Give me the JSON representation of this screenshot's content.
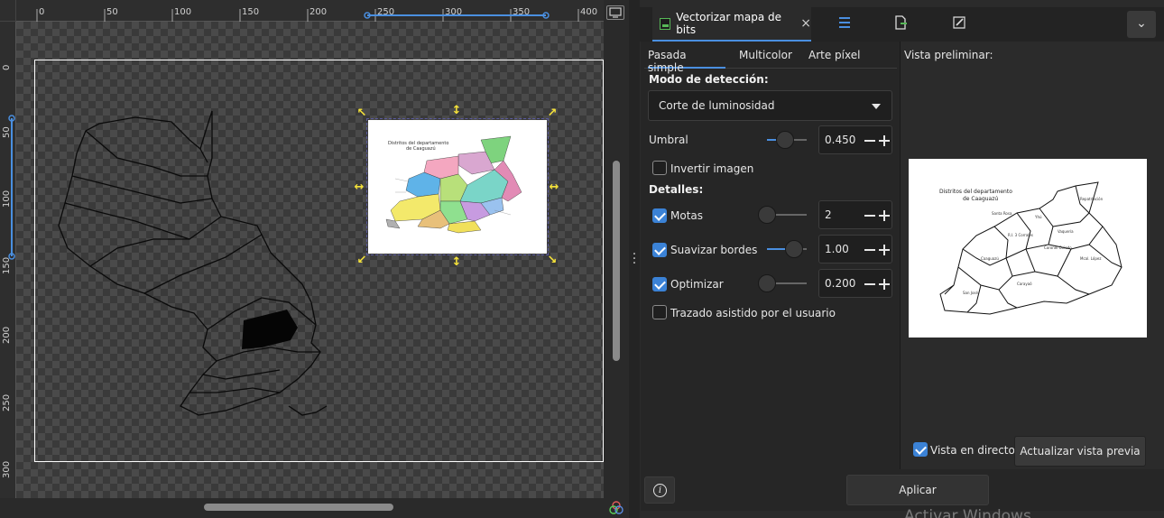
{
  "rulers": {
    "horizontal": [
      "0",
      "50",
      "100",
      "150",
      "200",
      "250",
      "300",
      "350",
      "400"
    ],
    "vertical": [
      "0",
      "50",
      "100",
      "150",
      "200",
      "250",
      "300"
    ]
  },
  "dialog": {
    "tab_title": "Vectorizar mapa de bits",
    "close_glyph": "×",
    "dock_icons": [
      "layers-icon",
      "export-icon",
      "edit-icon"
    ],
    "mode_tabs": [
      "Pasada simple",
      "Multicolor",
      "Arte píxel"
    ],
    "detection_mode_label": "Modo de detección:",
    "detection_mode_value": "Corte de luminosidad",
    "threshold_label": "Umbral",
    "threshold_value": "0.450",
    "invert_label": "Invertir imagen",
    "invert_checked": false,
    "details_label": "Detalles:",
    "speckles_label": "Motas",
    "speckles_checked": true,
    "speckles_value": "2",
    "smooth_label": "Suavizar bordes",
    "smooth_checked": true,
    "smooth_value": "1.00",
    "optimize_label": "Optimizar",
    "optimize_checked": true,
    "optimize_value": "0.200",
    "user_assisted_label": "Trazado asistido por el usuario",
    "user_assisted_checked": false,
    "preview_label": "Vista preliminar:",
    "live_label": "Vista en directo",
    "live_checked": true,
    "refresh_label": "Actualizar vista previa",
    "apply_label": "Aplicar"
  },
  "canvas_image": {
    "title_lines": [
      "Distritos del departamento",
      "de Caaguazú"
    ]
  },
  "watermark": "Activar Windows",
  "colors": {
    "accent": "#4a8fe0",
    "checkbox_on": "#3b82d6",
    "handle": "#f5e23a"
  }
}
